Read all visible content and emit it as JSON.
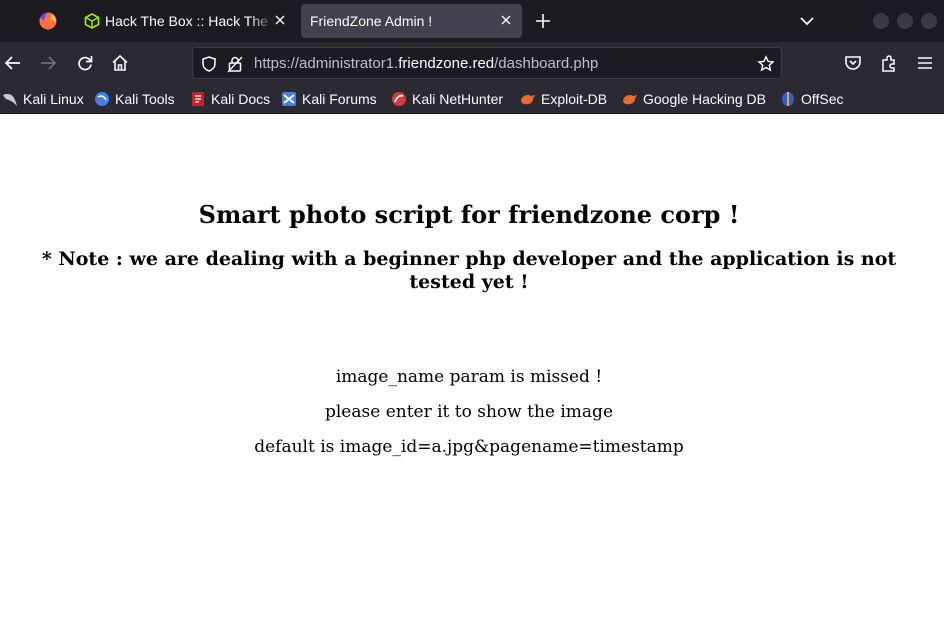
{
  "tabs": [
    {
      "title": "Hack The Box :: Hack The Box",
      "active": false,
      "favicon": "htb-cube-icon"
    },
    {
      "title": "FriendZone Admin !",
      "active": true
    }
  ],
  "address_bar": {
    "url_prefix": "https://administrator1.",
    "url_domain": "friendzone.red",
    "url_path": "/dashboard.php"
  },
  "bookmarks": [
    {
      "label": "Kali Linux",
      "icon": "kali-dragon-icon"
    },
    {
      "label": "Kali Tools",
      "icon": "kali-tools-icon"
    },
    {
      "label": "Kali Docs",
      "icon": "kali-docs-icon"
    },
    {
      "label": "Kali Forums",
      "icon": "kali-forums-icon"
    },
    {
      "label": "Kali NetHunter",
      "icon": "kali-nethunter-icon"
    },
    {
      "label": "Exploit-DB",
      "icon": "exploit-db-icon"
    },
    {
      "label": "Google Hacking DB",
      "icon": "ghdb-icon"
    },
    {
      "label": "OffSec",
      "icon": "offsec-icon"
    }
  ],
  "page": {
    "heading": "Smart photo script for friendzone corp !",
    "note": "* Note : we are dealing with a beginner php developer and the application is not tested yet !",
    "lines": [
      "image_name param is missed !",
      "please enter it to show the image",
      "default is image_id=a.jpg&pagename=timestamp"
    ]
  },
  "colors": {
    "tabstrip_bg": "#1c1b22",
    "toolbar_bg": "#2b2a33",
    "active_tab_bg": "#42414d",
    "text_light": "#fbfbfe"
  }
}
